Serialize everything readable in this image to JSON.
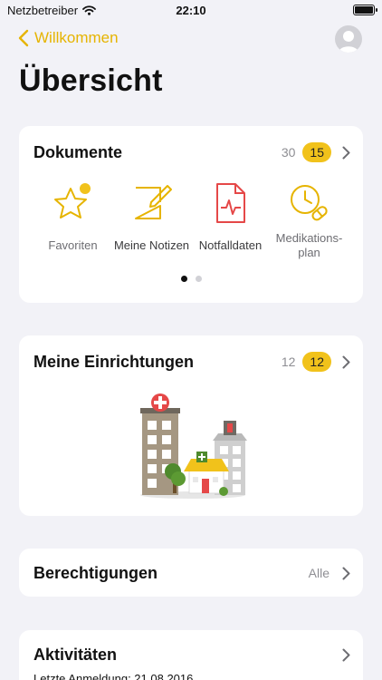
{
  "status_bar": {
    "carrier": "Netzbetreiber",
    "time": "22:10"
  },
  "nav": {
    "back_label": "Willkommen"
  },
  "page": {
    "title": "Übersicht"
  },
  "documents": {
    "title": "Dokumente",
    "count": "30",
    "badge": "15",
    "items": [
      {
        "icon": "star-icon",
        "label": "Favoriten"
      },
      {
        "icon": "notes-icon",
        "label": "Meine Notizen"
      },
      {
        "icon": "emergency-data-icon",
        "label": "Notfalldaten"
      },
      {
        "icon": "medication-plan-icon",
        "label": "Medikations-plan"
      }
    ],
    "pager": {
      "pages": 2,
      "current": 1
    }
  },
  "facilities": {
    "title": "Meine Einrichtungen",
    "count": "12",
    "badge": "12"
  },
  "permissions": {
    "title": "Berechtigungen",
    "value": "Alle"
  },
  "activities": {
    "title": "Aktivitäten",
    "last_login": "Letzte Anmeldung: 21.08.2016"
  },
  "colors": {
    "accent": "#f1c21b",
    "link": "#e6b400",
    "emergency": "#e54848",
    "background": "#f2f2f7"
  }
}
